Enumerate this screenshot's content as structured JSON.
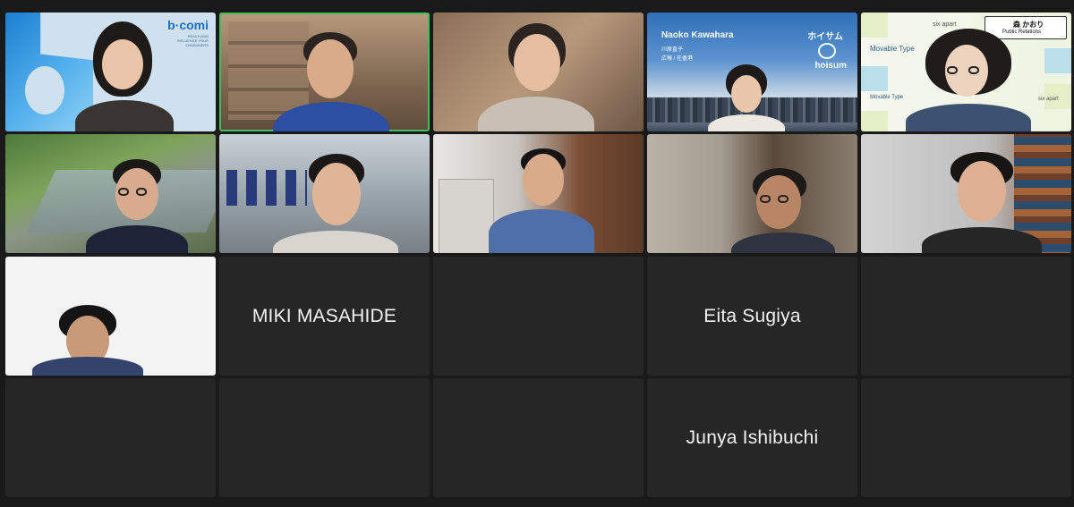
{
  "participants": [
    {
      "id": "p1",
      "label": "",
      "video": true,
      "logo": "b·comi",
      "logo_sub": "REACH AND INFLUENCE YOUR CONSUMERS"
    },
    {
      "id": "p2",
      "label": "",
      "video": true,
      "active_speaker": true
    },
    {
      "id": "p3",
      "label": "",
      "video": true
    },
    {
      "id": "p4",
      "label": "Naoko Kawahara",
      "video": true,
      "jp_name": "川原直子",
      "jp_role": "広報 / 在香港",
      "brand": "hoisum",
      "brand_jp": "ホイサム"
    },
    {
      "id": "p5",
      "label": "",
      "video": true,
      "jp_name": "森 かおり",
      "role": "Public Relations",
      "banner_text_1": "Movable Type",
      "banner_text_2": "six apart"
    },
    {
      "id": "p6",
      "label": "",
      "video": true
    },
    {
      "id": "p7",
      "label": "",
      "video": true
    },
    {
      "id": "p8",
      "label": "",
      "video": true
    },
    {
      "id": "p9",
      "label": "",
      "video": true
    },
    {
      "id": "p10",
      "label": "",
      "video": true
    },
    {
      "id": "p11",
      "label": "",
      "video": true
    },
    {
      "id": "p12",
      "label": "MIKI MASAHIDE",
      "video": false
    },
    {
      "id": "p13",
      "label": "",
      "video": false
    },
    {
      "id": "p14",
      "label": "Eita Sugiya",
      "video": false
    },
    {
      "id": "p15",
      "label": "",
      "video": false
    },
    {
      "id": "p16",
      "label": "",
      "video": false
    },
    {
      "id": "p17",
      "label": "",
      "video": false
    },
    {
      "id": "p18",
      "label": "",
      "video": false
    },
    {
      "id": "p19",
      "label": "Junya Ishibuchi",
      "video": false
    },
    {
      "id": "p20",
      "label": "",
      "video": false
    }
  ],
  "colors": {
    "background": "#1a1a1a",
    "tile": "#262626",
    "active_border": "#3ec15a"
  }
}
